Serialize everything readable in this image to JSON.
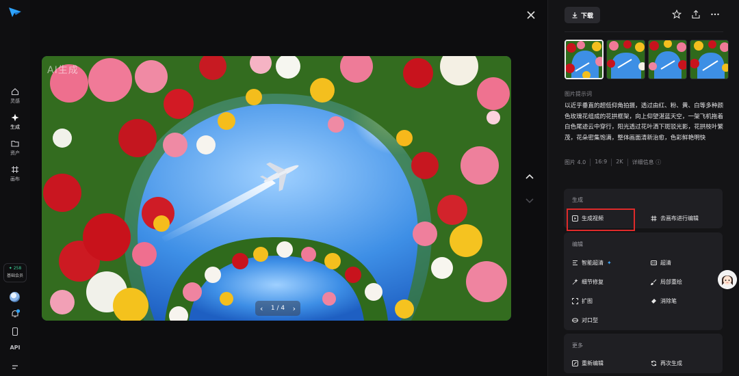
{
  "rail": {
    "nav": [
      {
        "label": "灵感",
        "icon": "home-icon"
      },
      {
        "label": "生成",
        "icon": "sparkle-icon"
      },
      {
        "label": "资产",
        "icon": "folder-icon"
      },
      {
        "label": "画布",
        "icon": "canvas-icon"
      }
    ],
    "member_points": "✦ 258",
    "member_label": "基础会员",
    "api_label": "API"
  },
  "viewer": {
    "watermark": "AI生成",
    "pager_text": "1 / 4",
    "prev": "‹",
    "next": "›"
  },
  "panel": {
    "download_label": "下载",
    "prompt_title": "图片提示词",
    "prompt_text": "以近乎垂直的超低仰角拍摄，透过由红、粉、黄、白等多种颜色玫瑰花组成的花拱框架，向上仰望湛蓝天空，一架飞机拖着白色尾迹云中穿行，阳光透过花叶洒下斑驳光影，花拱枝叶繁茂，花朵密集饱满，整体画面清新治愈，色彩鲜艳明快",
    "meta": [
      "图片 4.0",
      "16:9",
      "2K",
      "详细信息 ⓘ"
    ],
    "generate": {
      "title": "生成",
      "video": "生成视频",
      "canvas": "去画布进行编辑"
    },
    "edit": {
      "title": "编辑",
      "smart_hd": "智能超清",
      "hd": "超清",
      "detail_fix": "细节修复",
      "local_redraw": "局部重绘",
      "expand": "扩图",
      "eraser": "消除笔",
      "lip_sync": "对口型"
    },
    "more": {
      "title": "更多",
      "reedit": "重新编辑",
      "regenerate": "再次生成"
    }
  }
}
